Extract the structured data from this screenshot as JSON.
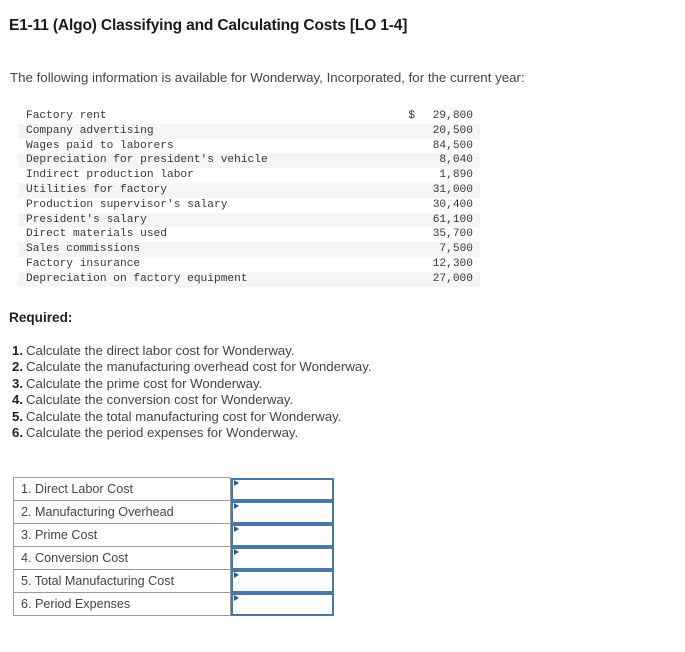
{
  "problem": {
    "title": "E1-11 (Algo) Classifying and Calculating Costs [LO 1-4]",
    "intro": "The following information is available for Wonderway, Incorporated, for the current year:",
    "required_heading": "Required:"
  },
  "cost_table": {
    "currency_symbol": "$",
    "rows": [
      {
        "label": "Factory rent",
        "currency": "$",
        "amount": "29,800"
      },
      {
        "label": "Company advertising",
        "currency": "",
        "amount": "20,500"
      },
      {
        "label": "Wages paid to laborers",
        "currency": "",
        "amount": "84,500"
      },
      {
        "label": "Depreciation for president's vehicle",
        "currency": "",
        "amount": "8,040"
      },
      {
        "label": "Indirect production labor",
        "currency": "",
        "amount": "1,890"
      },
      {
        "label": "Utilities for factory",
        "currency": "",
        "amount": "31,000"
      },
      {
        "label": "Production supervisor's salary",
        "currency": "",
        "amount": "30,400"
      },
      {
        "label": "President's salary",
        "currency": "",
        "amount": "61,100"
      },
      {
        "label": "Direct materials used",
        "currency": "",
        "amount": "35,700"
      },
      {
        "label": "Sales commissions",
        "currency": "",
        "amount": "7,500"
      },
      {
        "label": "Factory insurance",
        "currency": "",
        "amount": "12,300"
      },
      {
        "label": "Depreciation on factory equipment",
        "currency": "",
        "amount": "27,000"
      }
    ]
  },
  "requirements": [
    {
      "num": "1.",
      "text": "Calculate the direct labor cost for Wonderway."
    },
    {
      "num": "2.",
      "text": "Calculate the manufacturing overhead cost for Wonderway."
    },
    {
      "num": "3.",
      "text": "Calculate the prime cost for Wonderway."
    },
    {
      "num": "4.",
      "text": "Calculate the conversion cost for Wonderway."
    },
    {
      "num": "5.",
      "text": "Calculate the total manufacturing cost for Wonderway."
    },
    {
      "num": "6.",
      "text": "Calculate the period expenses for Wonderway."
    }
  ],
  "answer_table": {
    "rows": [
      {
        "label": "1. Direct Labor Cost",
        "value": "",
        "marker": "triangle-right-icon"
      },
      {
        "label": "2. Manufacturing Overhead",
        "value": "",
        "marker": "triangle-right-icon"
      },
      {
        "label": "3. Prime Cost",
        "value": "",
        "marker": "triangle-right-icon"
      },
      {
        "label": "4. Conversion Cost",
        "value": "",
        "marker": "triangle-right-icon"
      },
      {
        "label": "5. Total Manufacturing Cost",
        "value": "",
        "marker": "triangle-right-icon"
      },
      {
        "label": "6. Period Expenses",
        "value": "",
        "marker": "triangle-right-icon"
      }
    ]
  },
  "colors": {
    "input_border": "#4878a8",
    "input_marker": "#2f5c8f",
    "table_border": "#9a9a9a",
    "stripe": "#f5f5f5",
    "body_text": "#3f4549",
    "heading_text": "#1a1a1a"
  }
}
